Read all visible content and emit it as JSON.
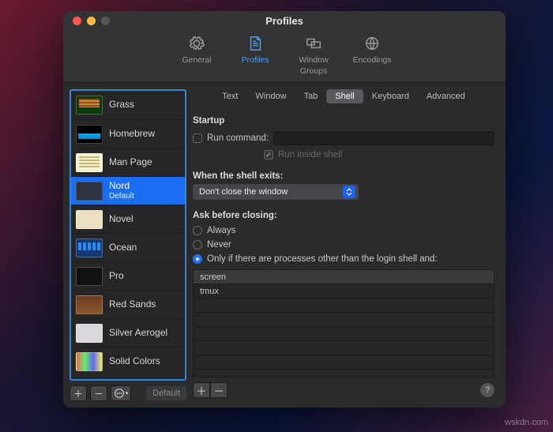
{
  "window": {
    "title": "Profiles"
  },
  "toolbar": {
    "items": [
      {
        "label": "General"
      },
      {
        "label": "Profiles"
      },
      {
        "label": "Window Groups"
      },
      {
        "label": "Encodings"
      }
    ]
  },
  "sidebar": {
    "profiles": [
      {
        "name": "Grass"
      },
      {
        "name": "Homebrew"
      },
      {
        "name": "Man Page"
      },
      {
        "name": "Nord",
        "default_label": "Default"
      },
      {
        "name": "Novel"
      },
      {
        "name": "Ocean"
      },
      {
        "name": "Pro"
      },
      {
        "name": "Red Sands"
      },
      {
        "name": "Silver Aerogel"
      },
      {
        "name": "Solid Colors"
      }
    ],
    "default_button": "Default"
  },
  "tabs": {
    "items": [
      "Text",
      "Window",
      "Tab",
      "Shell",
      "Keyboard",
      "Advanced"
    ]
  },
  "shell": {
    "startup_title": "Startup",
    "run_command_label": "Run command:",
    "run_inside_shell_label": "Run inside shell",
    "when_exits_title": "When the shell exits:",
    "when_exits_value": "Don't close the window",
    "ask_before_closing_title": "Ask before closing:",
    "radio_always": "Always",
    "radio_never": "Never",
    "radio_only_if": "Only if there are processes other than the login shell and:",
    "processes": [
      "screen",
      "tmux"
    ]
  },
  "watermark": "wskdn.com"
}
